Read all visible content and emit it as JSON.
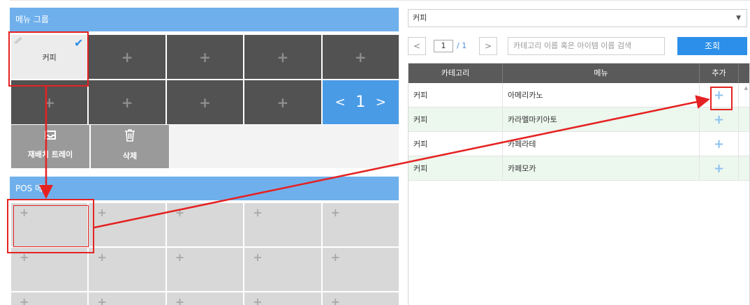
{
  "left": {
    "group_header": "메뉴 그룹",
    "groups": [
      {
        "label": "커피",
        "selected": true
      },
      {
        "label": "+"
      },
      {
        "label": "+"
      },
      {
        "label": "+"
      },
      {
        "label": "+"
      },
      {
        "label": "+"
      },
      {
        "label": "+"
      },
      {
        "label": "+"
      },
      {
        "label": "+"
      }
    ],
    "pager": {
      "prev": "<",
      "page": "1",
      "next": ">"
    },
    "tools": {
      "rearrange_label": "재배치 트레이",
      "delete_label": "삭제"
    },
    "pos_header": "POS 메뉴",
    "pos_cells": [
      "+",
      "+",
      "+",
      "+",
      "+",
      "+",
      "+",
      "+",
      "+",
      "+",
      "+",
      "+",
      "+",
      "+",
      "+"
    ]
  },
  "right": {
    "category_select": "커피",
    "pager": {
      "prev": "<",
      "page": "1",
      "total": "/ 1",
      "next": ">"
    },
    "search_placeholder": "카테고리 이름 혹은 아이템 이름 검색",
    "query_label": "조회",
    "table": {
      "headers": [
        "카테고리",
        "메뉴",
        "추가"
      ],
      "rows": [
        {
          "category": "커피",
          "menu": "아메리카노",
          "add": "+"
        },
        {
          "category": "커피",
          "menu": "카라멜마키아토",
          "add": "+"
        },
        {
          "category": "커피",
          "menu": "카페라테",
          "add": "+"
        },
        {
          "category": "커피",
          "menu": "카페모카",
          "add": "+"
        }
      ]
    }
  },
  "colors": {
    "header_blue": "#6fb0ec",
    "button_blue": "#2c8fe9",
    "dark_cell": "#525252",
    "annotation_red": "#e52222"
  },
  "icons": [
    "check-icon",
    "pencil-icon",
    "tray-icon",
    "trash-icon",
    "plus-icon",
    "dropdown-arrow-icon"
  ]
}
